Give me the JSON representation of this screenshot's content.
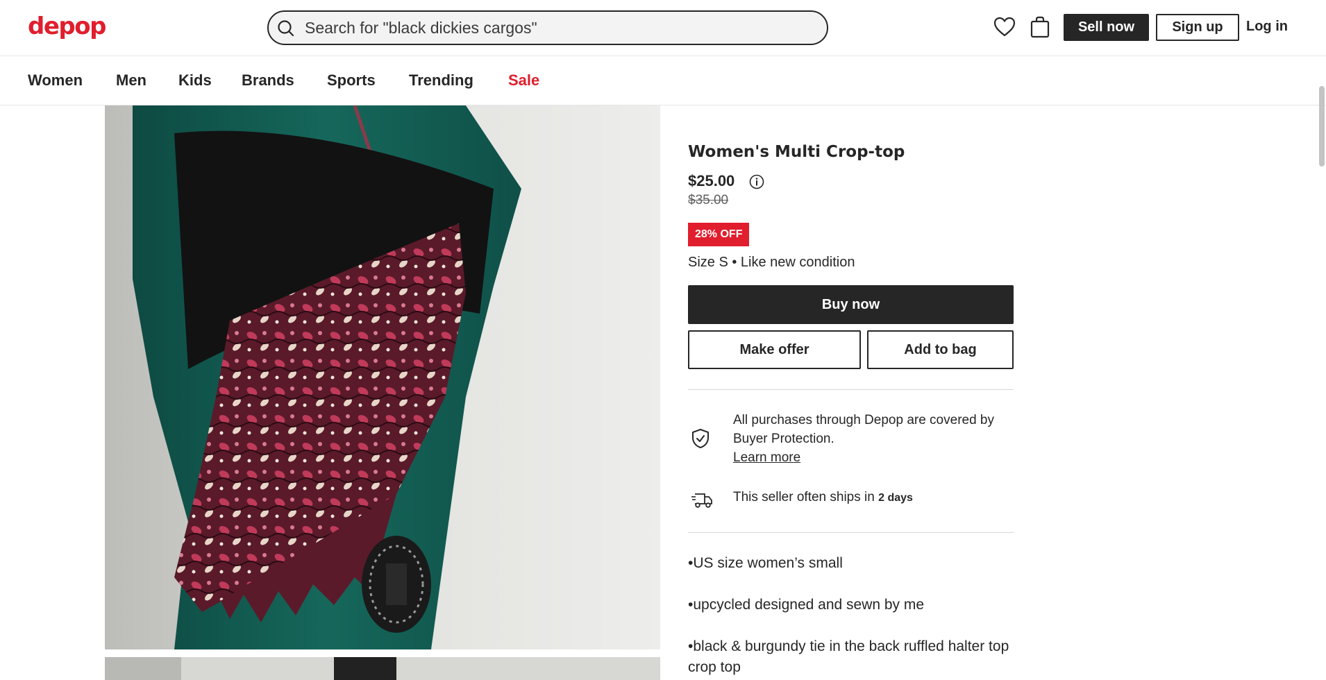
{
  "header": {
    "logo": "depop",
    "search_placeholder": "Search for \"black dickies cargos\"",
    "sell_label": "Sell now",
    "signup_label": "Sign up",
    "login_label": "Log in"
  },
  "nav": {
    "items": [
      "Women",
      "Men",
      "Kids",
      "Brands",
      "Sports",
      "Trending",
      "Sale"
    ]
  },
  "product": {
    "title": "Women's Multi Crop-top",
    "price": "$25.00",
    "original_price": "$35.00",
    "discount": "28% OFF",
    "size_condition": "Size S • Like new condition",
    "buy_label": "Buy now",
    "offer_label": "Make offer",
    "bag_label": "Add to bag",
    "protection_text": "All purchases through Depop are covered by Buyer Protection.",
    "learn_more": "Learn more",
    "ships_text": "This seller often ships in",
    "ships_days": "2 days",
    "description": [
      "•US size women’s small",
      "•upcycled designed and sewn by me",
      "•black & burgundy tie in the back ruffled halter top crop top"
    ]
  },
  "colors": {
    "brand_red": "#e01e2e",
    "dark": "#262626"
  }
}
